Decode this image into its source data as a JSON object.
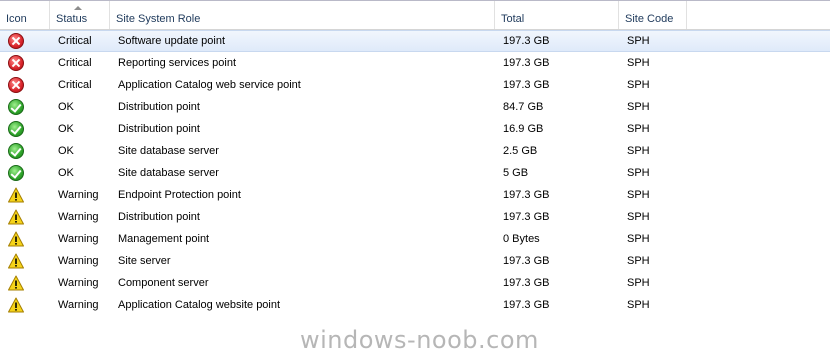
{
  "columns": {
    "icon": "Icon",
    "status": "Status",
    "role": "Site System Role",
    "total": "Total",
    "code": "Site Code"
  },
  "rows": [
    {
      "icon": "error-icon",
      "status": "Critical",
      "role": "Software update point",
      "total": "197.3 GB",
      "code": "SPH",
      "selected": true
    },
    {
      "icon": "error-icon",
      "status": "Critical",
      "role": "Reporting services point",
      "total": "197.3 GB",
      "code": "SPH"
    },
    {
      "icon": "error-icon",
      "status": "Critical",
      "role": "Application Catalog web service point",
      "total": "197.3 GB",
      "code": "SPH"
    },
    {
      "icon": "ok-icon",
      "status": "OK",
      "role": "Distribution point",
      "total": "84.7 GB",
      "code": "SPH"
    },
    {
      "icon": "ok-icon",
      "status": "OK",
      "role": "Distribution point",
      "total": "16.9 GB",
      "code": "SPH"
    },
    {
      "icon": "ok-icon",
      "status": "OK",
      "role": "Site database server",
      "total": "2.5 GB",
      "code": "SPH"
    },
    {
      "icon": "ok-icon",
      "status": "OK",
      "role": "Site database server",
      "total": "5 GB",
      "code": "SPH"
    },
    {
      "icon": "warning-icon",
      "status": "Warning",
      "role": "Endpoint Protection point",
      "total": "197.3 GB",
      "code": "SPH"
    },
    {
      "icon": "warning-icon",
      "status": "Warning",
      "role": "Distribution point",
      "total": "197.3 GB",
      "code": "SPH"
    },
    {
      "icon": "warning-icon",
      "status": "Warning",
      "role": "Management point",
      "total": "0 Bytes",
      "code": "SPH"
    },
    {
      "icon": "warning-icon",
      "status": "Warning",
      "role": "Site server",
      "total": "197.3 GB",
      "code": "SPH"
    },
    {
      "icon": "warning-icon",
      "status": "Warning",
      "role": "Component server",
      "total": "197.3 GB",
      "code": "SPH"
    },
    {
      "icon": "warning-icon",
      "status": "Warning",
      "role": "Application Catalog website point",
      "total": "197.3 GB",
      "code": "SPH"
    }
  ],
  "sort_indicator_icon": "sort-ascending-icon",
  "watermark": "windows-noob.com",
  "colors": {
    "header_text": "#1e395b",
    "selection": "#dfeafa",
    "critical": "#d8232a",
    "ok": "#2ea42a",
    "warning": "#f5d31a"
  }
}
